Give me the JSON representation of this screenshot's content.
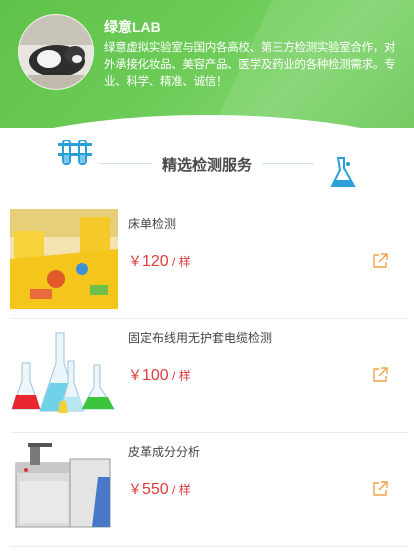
{
  "header": {
    "brand": "绿意LAB",
    "intro": "绿意虚拟实验室与国内各高校、第三方检测实验室合作，对外承接化妆品、美容产品、医学及药业的各种检测需求。专业、科学、精准、诚信！"
  },
  "section": {
    "title": "精选检测服务",
    "left_icon": "test-tubes-icon",
    "right_icon": "flask-icon"
  },
  "items": [
    {
      "name": "床单检测",
      "currency": "￥",
      "amount": "120",
      "unit": " / 样",
      "link_icon": "external-link-icon"
    },
    {
      "name": "固定布线用无护套电缆检测",
      "currency": "￥",
      "amount": "100",
      "unit": " / 样",
      "link_icon": "external-link-icon"
    },
    {
      "name": "皮革成分分析",
      "currency": "￥",
      "amount": "550",
      "unit": " / 样",
      "link_icon": "external-link-icon"
    }
  ],
  "colors": {
    "header_green": "#6ccb57",
    "price_red": "#e03b3b",
    "link_orange": "#f0a24a",
    "icon_blue": "#2a9fd8"
  }
}
